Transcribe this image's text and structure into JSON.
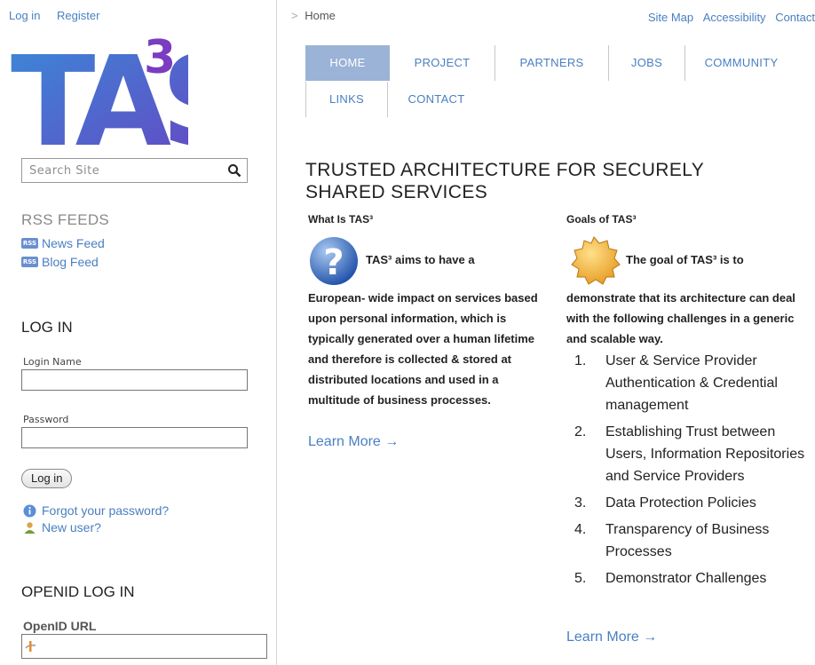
{
  "auth": {
    "login": "Log in",
    "register": "Register"
  },
  "logo": {
    "text": "TAS",
    "superscript": "3"
  },
  "search": {
    "placeholder": "Search Site"
  },
  "rss": {
    "heading": "RSS FEEDS",
    "badge": "RSS",
    "items": [
      "News Feed",
      "Blog Feed"
    ]
  },
  "login_form": {
    "heading": "LOG IN",
    "name_label": "Login Name",
    "password_label": "Password",
    "submit": "Log in",
    "forgot": "Forgot your password?",
    "new_user": "New user?"
  },
  "openid": {
    "heading": "OPENID LOG IN",
    "label": "OpenID URL"
  },
  "breadcrumb": {
    "separator": ">",
    "current": "Home"
  },
  "site_actions": [
    "Site Map",
    "Accessibility",
    "Contact"
  ],
  "nav": [
    "HOME",
    "PROJECT",
    "PARTNERS",
    "JOBS",
    "COMMUNITY",
    "LINKS",
    "CONTACT"
  ],
  "page_title": "TRUSTED ARCHITECTURE FOR SECURELY SHARED SERVICES",
  "what": {
    "heading": "What Is TAS³",
    "lead": "TAS³ aims to have a",
    "body": "European- wide impact on services based upon personal information, which is typically generated over a human lifetime and therefore is collected & stored at distributed locations and used in a multitude of business processes.",
    "learn_more": "Learn More →"
  },
  "goals": {
    "heading": "Goals of TAS³",
    "lead": "The goal of TAS³ is to",
    "body": "demonstrate that its architecture can deal with the following challenges in a generic and scalable way.",
    "items": [
      "User & Service Provider Authentication & Credential management",
      "Establishing Trust between Users, Information Repositories and Service Providers",
      "Data Protection Policies",
      "Transparency of Business Processes",
      "Demonstrator Challenges"
    ],
    "learn_more": "Learn More →"
  },
  "colors": {
    "link": "#4a7fc1",
    "nav_active": "#9ab3d6",
    "logo_blue": "#3d6fd0"
  },
  "icons": {
    "search": "magnifier-icon",
    "rss": "rss-icon",
    "info": "info-icon",
    "user": "user-icon",
    "openid": "openid-icon",
    "question": "question-mark-icon",
    "seal": "seal-badge-icon"
  }
}
